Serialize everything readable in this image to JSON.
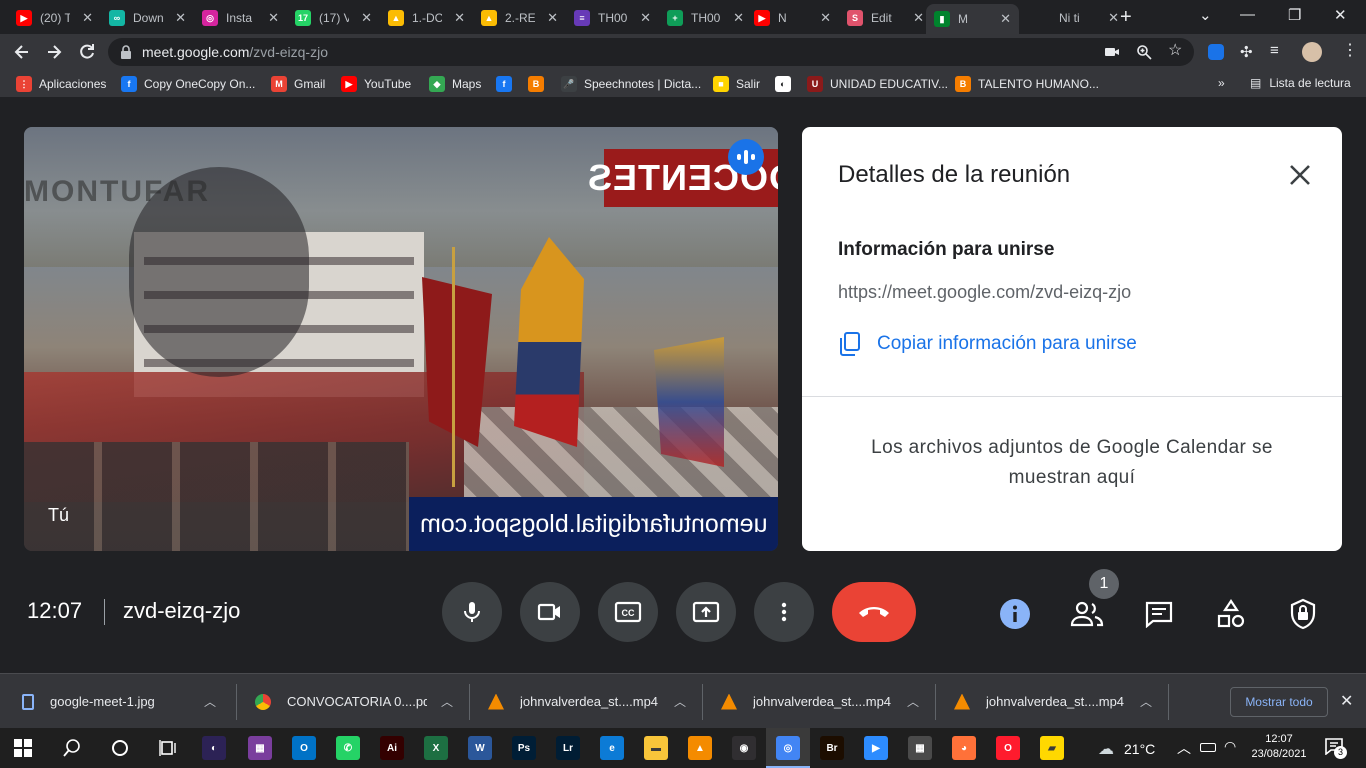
{
  "browser": {
    "tabs": [
      {
        "title": "(20) T",
        "color": "#ff0000",
        "glyph": "▶"
      },
      {
        "title": "Down",
        "color": "#13b6a4",
        "glyph": "∞"
      },
      {
        "title": "Insta",
        "color": "#d6249f",
        "glyph": "◎"
      },
      {
        "title": "(17) V",
        "color": "#25d366",
        "glyph": "17"
      },
      {
        "title": "1.-DC",
        "color": "#fbbc04",
        "glyph": "▲"
      },
      {
        "title": "2.-RE",
        "color": "#fbbc04",
        "glyph": "▲"
      },
      {
        "title": "TH00",
        "color": "#673ab7",
        "glyph": "≡"
      },
      {
        "title": "TH00",
        "color": "#0f9d58",
        "glyph": "+"
      },
      {
        "title": "N",
        "color": "#ff0000",
        "glyph": "▶"
      },
      {
        "title": "Edit",
        "color": "#e0536c",
        "glyph": "S"
      },
      {
        "title": "M",
        "color": "#00832d",
        "glyph": "▮"
      },
      {
        "title": "Ni ti",
        "color": "#202124",
        "glyph": ""
      }
    ],
    "url_host": "meet.google.com",
    "url_path": "/zvd-eizq-zjo",
    "bookmarks": [
      {
        "label": "Aplicaciones",
        "color": "#ea4335",
        "glyph": "⋮"
      },
      {
        "label": "Copy OneCopy On...",
        "color": "#1877f2",
        "glyph": "f"
      },
      {
        "label": "Gmail",
        "color": "#ea4335",
        "glyph": "M"
      },
      {
        "label": "YouTube",
        "color": "#ff0000",
        "glyph": "▶"
      },
      {
        "label": "Maps",
        "color": "#34a853",
        "glyph": "◆"
      },
      {
        "label": "",
        "color": "#1877f2",
        "glyph": "f"
      },
      {
        "label": "",
        "color": "#f57d00",
        "glyph": "B"
      },
      {
        "label": "Speechnotes | Dicta...",
        "color": "#3c4043",
        "glyph": "🎤"
      },
      {
        "label": "Salir",
        "color": "#ffd400",
        "glyph": "■"
      },
      {
        "label": "",
        "color": "#ffffff",
        "glyph": "◐"
      },
      {
        "label": "UNIDAD EDUCATIV...",
        "color": "#8b1a1a",
        "glyph": "U"
      },
      {
        "label": "TALENTO HUMANO...",
        "color": "#f57d00",
        "glyph": "B"
      }
    ],
    "reading_list": "Lista de lectura"
  },
  "video": {
    "self_label": "Tú",
    "banner_top": "DOCENTES",
    "banner_bottom": "uemontufardigital.blogspot.com",
    "watermark": "MONTUFAR"
  },
  "panel": {
    "title": "Detalles de la reunión",
    "join_heading": "Información para unirse",
    "join_url": "https://meet.google.com/zvd-eizq-zjo",
    "copy_label": "Copiar información para unirse",
    "attachments_text_line1": "Los archivos adjuntos de Google Calendar se",
    "attachments_text_line2": "muestran aquí"
  },
  "meeting_bar": {
    "time": "12:07",
    "code": "zvd-eizq-zjo",
    "participants_count": "1"
  },
  "downloads": {
    "items": [
      {
        "name": "google-meet-1.jpg",
        "icon": "file-icon"
      },
      {
        "name": "CONVOCATORIA 0....pdf",
        "icon": "chrome-icon"
      },
      {
        "name": "johnvalverdea_st....mp4",
        "icon": "vlc-icon"
      },
      {
        "name": "johnvalverdea_st....mp4",
        "icon": "vlc-icon"
      },
      {
        "name": "johnvalverdea_st....mp4",
        "icon": "vlc-icon"
      }
    ],
    "show_all": "Mostrar todo"
  },
  "taskbar": {
    "apps": [
      {
        "name": "eclipse-icon",
        "color": "#2c2255",
        "glyph": "◐"
      },
      {
        "name": "winrar-icon",
        "color": "#7a3e9d",
        "glyph": "▦"
      },
      {
        "name": "outlook-icon",
        "color": "#0072c6",
        "glyph": "O"
      },
      {
        "name": "whatsapp-icon",
        "color": "#25d366",
        "glyph": "✆"
      },
      {
        "name": "illustrator-icon",
        "color": "#330000",
        "glyph": "Ai"
      },
      {
        "name": "excel-icon",
        "color": "#1d6f42",
        "glyph": "X"
      },
      {
        "name": "word-icon",
        "color": "#2b579a",
        "glyph": "W"
      },
      {
        "name": "photoshop-icon",
        "color": "#001e36",
        "glyph": "Ps"
      },
      {
        "name": "lightroom-icon",
        "color": "#001d34",
        "glyph": "Lr"
      },
      {
        "name": "edge-icon",
        "color": "#0c7bd6",
        "glyph": "e"
      },
      {
        "name": "explorer-icon",
        "color": "#f8c53a",
        "glyph": "▬"
      },
      {
        "name": "vlc-icon",
        "color": "#f48b00",
        "glyph": "▲"
      },
      {
        "name": "obs-icon",
        "color": "#302e31",
        "glyph": "◉"
      },
      {
        "name": "chrome-icon",
        "color": "#4285f4",
        "glyph": "◎"
      },
      {
        "name": "bridge-icon",
        "color": "#1c0d00",
        "glyph": "Br"
      },
      {
        "name": "zoom-icon",
        "color": "#2d8cff",
        "glyph": "▶"
      },
      {
        "name": "calculator-icon",
        "color": "#4a4a4a",
        "glyph": "▦"
      },
      {
        "name": "firefox-icon",
        "color": "#ff7139",
        "glyph": "◕"
      },
      {
        "name": "opera-icon",
        "color": "#ff1b2d",
        "glyph": "O"
      },
      {
        "name": "sticky-notes-icon",
        "color": "#ffd800",
        "glyph": "▰"
      }
    ],
    "temperature": "21°C",
    "clock_time": "12:07",
    "clock_date": "23/08/2021",
    "notification_count": "3"
  },
  "colors": {
    "accent_blue": "#1a73e8",
    "end_call_red": "#ea4335",
    "meet_bg": "#202124",
    "control_bg": "#3c4043"
  }
}
